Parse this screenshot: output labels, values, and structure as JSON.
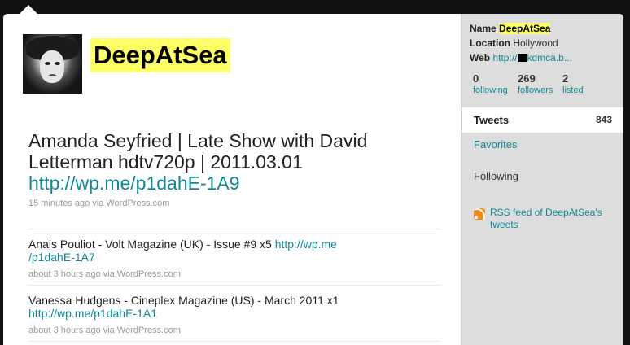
{
  "profile": {
    "screen_name": "DeepAtSea",
    "name_label": "Name",
    "name_value": "DeepAtSea",
    "location_label": "Location",
    "location_value": "Hollywood",
    "web_label": "Web",
    "web_url_start": "http://",
    "web_url_end": "kdmca.b..."
  },
  "stats": {
    "following": {
      "count": "0",
      "label": "following"
    },
    "followers": {
      "count": "269",
      "label": "followers"
    },
    "listed": {
      "count": "2",
      "label": "listed"
    }
  },
  "sidebar": {
    "tweets_label": "Tweets",
    "tweets_count": "843",
    "favorites": "Favorites",
    "following": "Following",
    "rss": "RSS feed of DeepAtSea's tweets"
  },
  "featured_tweet": {
    "text": "Amanda Seyfried | Late Show with David Letterman hdtv720p | 2011.03.01",
    "link": "http://wp.me/p1dahE-1A9",
    "meta": "15 minutes ago via WordPress.com"
  },
  "tweets": [
    {
      "text": "Anais Pouliot - Volt Magazine (UK) - Issue #9 x5",
      "link": "http://wp.me/p1dahE-1A7",
      "meta": "about 3 hours ago via WordPress.com"
    },
    {
      "text": "Vanessa Hudgens - Cineplex Magazine (US) - March 2011 x1",
      "link": "http://wp.me/p1dahE-1A1",
      "meta": "about 3 hours ago via WordPress.com"
    }
  ],
  "colors": {
    "link": "#0f8a94",
    "highlight": "#ffff66",
    "sidebar_bg": "#dddddd",
    "page_bg": "#111111"
  }
}
